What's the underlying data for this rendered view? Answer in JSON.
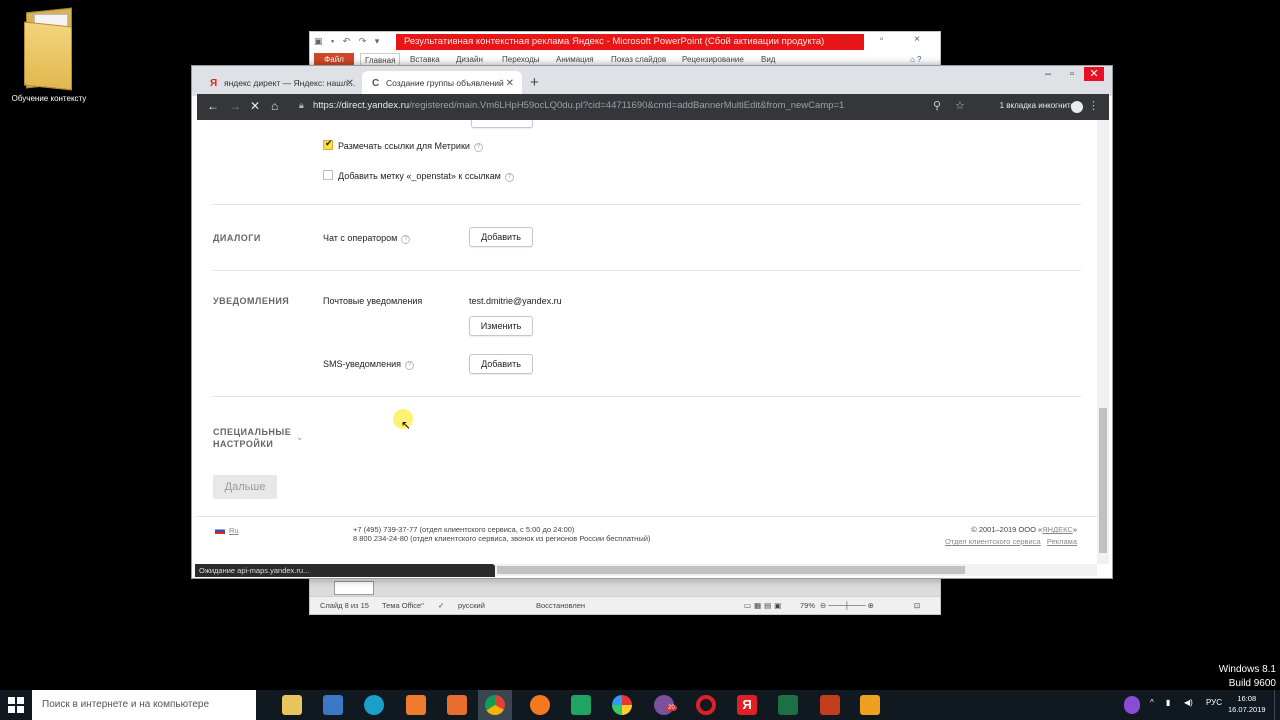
{
  "desktop": {
    "icon_label": "Обучение контексту",
    "windows_version": "Windows 8.1",
    "build": "Build 9600"
  },
  "powerpoint": {
    "title": "Результативная контекстная реклама Яндекс  -  Microsoft PowerPoint (Сбой активации продукта)",
    "tabs": [
      "Файл",
      "Главная",
      "Вставка",
      "Дизайн",
      "Переходы",
      "Анимация",
      "Показ слайдов",
      "Рецензирование",
      "Вид"
    ],
    "status": {
      "slide": "Слайд 8 из 15",
      "theme": "Тема Office\"",
      "language": "русский",
      "restored": "Восстановлен",
      "zoom": "79%"
    }
  },
  "browser": {
    "tabs": [
      {
        "icon": "Я",
        "title": "яндекс директ — Яндекс: нашл..."
      },
      {
        "icon": "C",
        "title": "Создание группы объявлений"
      }
    ],
    "url_host": "https://direct.yandex.ru",
    "url_path": "/registered/main.Vm6LHpH59ocLQ0du.pl?cid=44711690&cmd=addBannerMultiEdit&from_newCamp=1",
    "incognito_label": "1 вкладка инкогнито",
    "status_text": "Ожидание api-maps.yandex.ru..."
  },
  "form": {
    "checkbox_metrika": {
      "label": "Размечать ссылки для Метрики",
      "checked": true
    },
    "checkbox_openstat": {
      "label": "Добавить метку «_openstat» к ссылкам",
      "checked": false
    },
    "dialogs": {
      "header": "ДИАЛОГИ",
      "chat_label": "Чат с оператором",
      "add_button": "Добавить"
    },
    "notifications": {
      "header": "УВЕДОМЛЕНИЯ",
      "email_label": "Почтовые уведомления",
      "email_value": "test.dmitrie@yandex.ru",
      "change_button": "Изменить",
      "sms_label": "SMS-уведомления",
      "sms_add_button": "Добавить"
    },
    "special": {
      "header_line1": "СПЕЦИАЛЬНЫЕ",
      "header_line2": "НАСТРОЙКИ"
    },
    "next_button": "Дальше"
  },
  "footer": {
    "lang": "Ru",
    "phone1": "+7 (495) 739-37-77 (отдел клиентского сервиса, с 5:00 до 24:00)",
    "phone2": "8 800 234-24-80 (отдел клиентского сервиса, звонок из регионов России бесплатный)",
    "copyright_prefix": "© 2001–2019 ООО «",
    "copyright_brand": "ЯНДЕКС",
    "copyright_suffix": "»",
    "link_support": "Отдел клиентского сервиса",
    "link_ads": "Реклама"
  },
  "taskbar": {
    "search_placeholder": "Поиск в интернете и на компьютере",
    "lang": "РУС",
    "time": "16:08",
    "date": "16.07.2019",
    "viber_badge": "20"
  },
  "colors": {
    "ppt_red": "#e81616",
    "yandex_yellow": "#ffdb4d",
    "taskbar": "#101820",
    "chrome_dark": "#35363a"
  }
}
